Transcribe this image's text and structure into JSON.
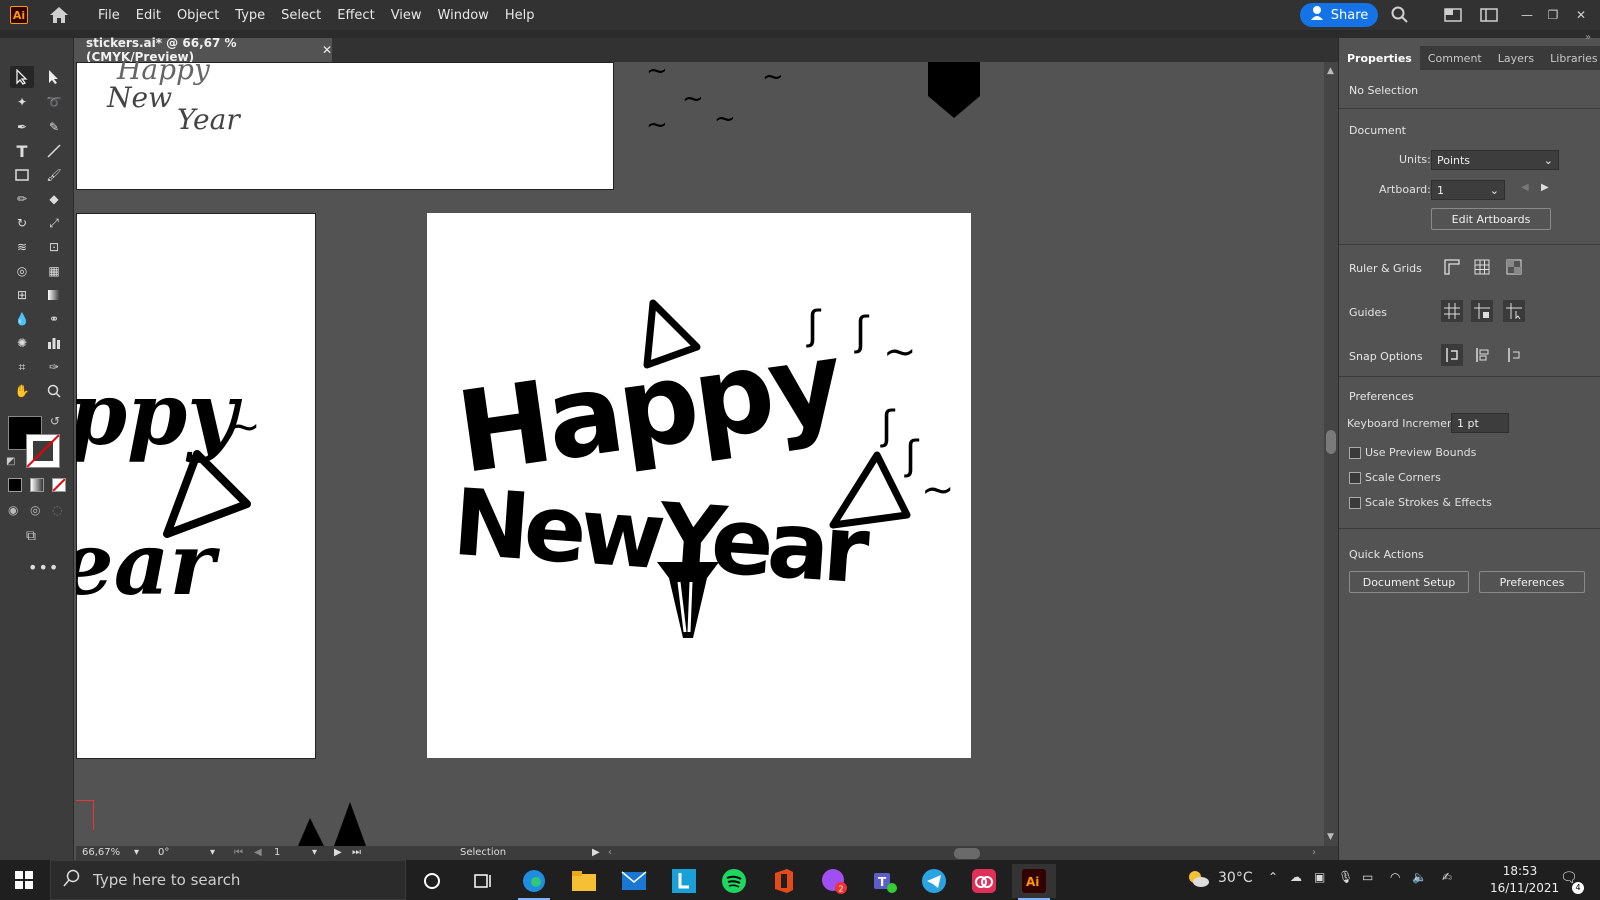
{
  "menu": {
    "items": [
      "File",
      "Edit",
      "Object",
      "Type",
      "Select",
      "Effect",
      "View",
      "Window",
      "Help"
    ],
    "share_label": "Share"
  },
  "document": {
    "tab_title": "stickers.ai* @ 66,67 % (CMYK/Preview)"
  },
  "artwork": {
    "small_text_line1": "Happy",
    "small_text_line2": "New",
    "small_text_line3": "Year",
    "left_text_line1": "ppy",
    "left_text_line2": "ear",
    "main_line1": "Happy",
    "main_line2": "NewYear"
  },
  "status_bar": {
    "zoom": "66,67%",
    "rotation": "0°",
    "artboard": "1",
    "tool": "Selection"
  },
  "panel": {
    "tabs": [
      "Properties",
      "Comment",
      "Layers",
      "Libraries"
    ],
    "no_selection": "No Selection",
    "document_heading": "Document",
    "units_label": "Units:",
    "units_value": "Points",
    "artboard_label": "Artboard:",
    "artboard_value": "1",
    "edit_artboards": "Edit Artboards",
    "ruler_grids": "Ruler & Grids",
    "guides": "Guides",
    "snap_options": "Snap Options",
    "preferences_heading": "Preferences",
    "keyboard_increment_label": "Keyboard Increment:",
    "keyboard_increment_value": "1 pt",
    "use_preview_bounds": "Use Preview Bounds",
    "scale_corners": "Scale Corners",
    "scale_strokes": "Scale Strokes & Effects",
    "quick_actions": "Quick Actions",
    "document_setup": "Document Setup",
    "preferences_btn": "Preferences"
  },
  "taskbar": {
    "search_placeholder": "Type here to search",
    "weather": "30°C",
    "time": "18:53",
    "date": "16/11/2021",
    "notifications": "4"
  },
  "colors": {
    "share_blue": "#1473e6",
    "ai_orange": "#ff9a00"
  }
}
